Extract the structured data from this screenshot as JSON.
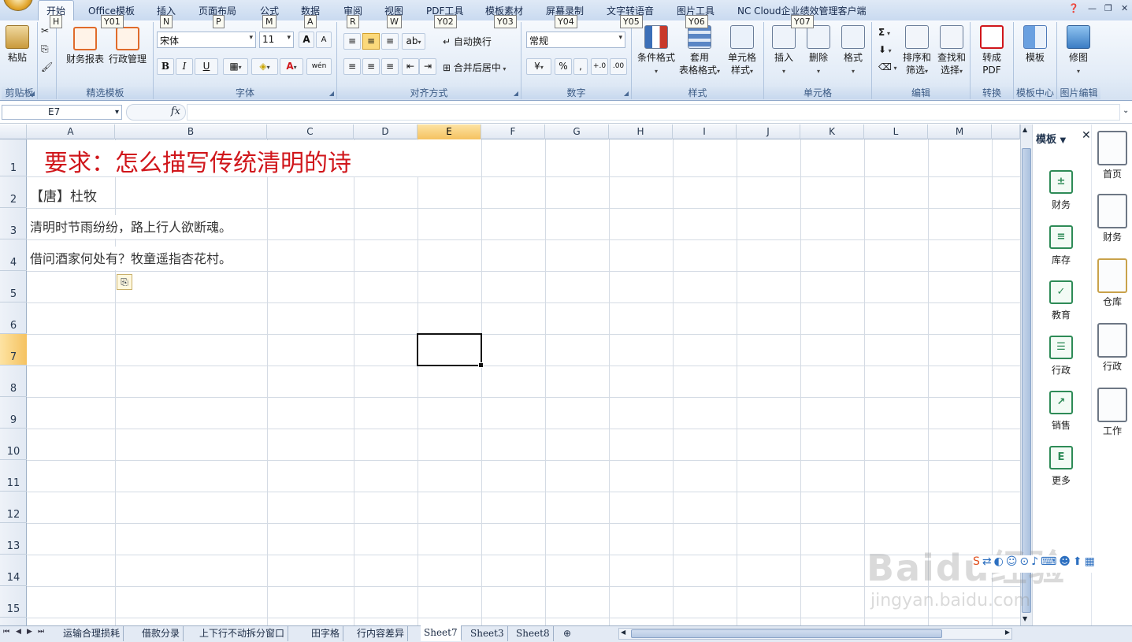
{
  "tabs": [
    {
      "label": "开始",
      "key": "H",
      "active": true
    },
    {
      "label": "Office模板",
      "key": "Y01"
    },
    {
      "label": "插入",
      "key": "N"
    },
    {
      "label": "页面布局",
      "key": "P"
    },
    {
      "label": "公式",
      "key": "M"
    },
    {
      "label": "数据",
      "key": "A"
    },
    {
      "label": "审阅",
      "key": "R"
    },
    {
      "label": "视图",
      "key": "W"
    },
    {
      "label": "PDF工具",
      "key": "Y02"
    },
    {
      "label": "模板素材",
      "key": "Y03"
    },
    {
      "label": "屏幕录制",
      "key": "Y04"
    },
    {
      "label": "文字转语音",
      "key": "Y05"
    },
    {
      "label": "图片工具",
      "key": "Y06"
    },
    {
      "label": "NC Cloud企业绩效管理客户端",
      "key": "Y07"
    }
  ],
  "ribbon": {
    "clipboard": {
      "group": "剪贴板",
      "paste": "粘贴"
    },
    "templates": {
      "group": "精选模板",
      "finance": "财务报表",
      "admin": "行政管理"
    },
    "font": {
      "group": "字体",
      "name": "宋体",
      "size": "11",
      "bold": "B",
      "italic": "I",
      "underline": "U",
      "grow": "A",
      "shrink": "A",
      "wen": "wén"
    },
    "align": {
      "group": "对齐方式",
      "wrap": "自动换行",
      "merge": "合并后居中"
    },
    "number": {
      "group": "数字",
      "format": "常规",
      "percent": "%",
      "comma": ",",
      "incdec": "+.0",
      "decdec": ".00"
    },
    "styles": {
      "group": "样式",
      "cond": "条件格式",
      "table1": "套用",
      "table2": "表格格式",
      "cell1": "单元格",
      "cell2": "样式"
    },
    "cells": {
      "group": "单元格",
      "insert": "插入",
      "delete": "删除",
      "format": "格式"
    },
    "edit": {
      "group": "编辑",
      "sigma": "Σ",
      "sort1": "排序和",
      "sort2": "筛选",
      "find1": "查找和",
      "find2": "选择"
    },
    "convert": {
      "group": "转换",
      "pdf1": "转成",
      "pdf2": "PDF"
    },
    "tplcenter": {
      "group": "模板中心",
      "tpl": "模板"
    },
    "imgedit": {
      "group": "图片编辑",
      "img": "修图"
    }
  },
  "formula": {
    "namebox": "E7",
    "fx": "fx",
    "value": ""
  },
  "columns": [
    "A",
    "B",
    "C",
    "D",
    "E",
    "F",
    "G",
    "H",
    "I",
    "J",
    "K",
    "L",
    "M"
  ],
  "selected_col": "E",
  "rows": [
    "1",
    "2",
    "3",
    "4",
    "5",
    "6",
    "7",
    "8",
    "9",
    "10",
    "11",
    "12",
    "13",
    "14",
    "15"
  ],
  "selected_row": "7",
  "cells": {
    "A1": "要求：怎么描写传统清明的诗",
    "A2": "【唐】杜牧",
    "A3": "清明时节雨纷纷，路上行人欲断魂。",
    "A4": "借问酒家何处有？牧童遥指杏花村。"
  },
  "colors": {
    "title": "#d0161b",
    "accent": "#f5c260",
    "ribbon": "#dfe9f6"
  },
  "panel": {
    "title": "模板",
    "items": [
      "财务",
      "库存",
      "教育",
      "行政",
      "销售",
      "更多"
    ]
  },
  "rail": {
    "items": [
      "首页",
      "财务",
      "仓库",
      "行政",
      "工作"
    ]
  },
  "sheets": [
    {
      "name": "运输合理损耗"
    },
    {
      "name": "借款分录"
    },
    {
      "name": "上下行不动拆分窗口"
    },
    {
      "name": "田字格"
    },
    {
      "name": "行内容差异"
    },
    {
      "name": "Sheet7",
      "active": true
    },
    {
      "name": "Sheet3"
    },
    {
      "name": "Sheet8"
    }
  ],
  "watermark": {
    "brand": "Baidu经验",
    "url": "jingyan.baidu.com"
  }
}
